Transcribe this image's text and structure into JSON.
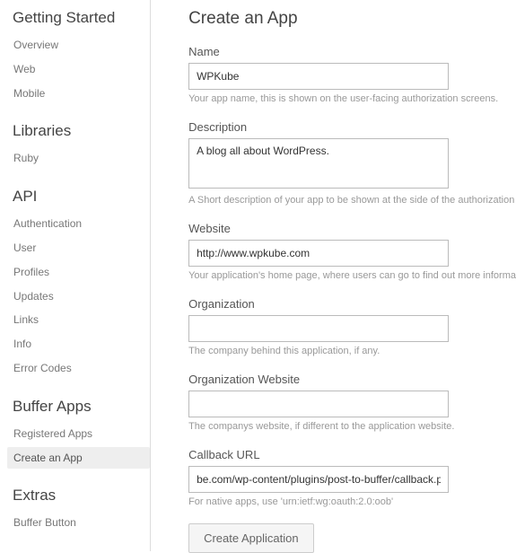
{
  "sidebar": {
    "sections": [
      {
        "header": "Getting Started",
        "items": [
          {
            "label": "Overview",
            "active": false
          },
          {
            "label": "Web",
            "active": false
          },
          {
            "label": "Mobile",
            "active": false
          }
        ]
      },
      {
        "header": "Libraries",
        "items": [
          {
            "label": "Ruby",
            "active": false
          }
        ]
      },
      {
        "header": "API",
        "items": [
          {
            "label": "Authentication",
            "active": false
          },
          {
            "label": "User",
            "active": false
          },
          {
            "label": "Profiles",
            "active": false
          },
          {
            "label": "Updates",
            "active": false
          },
          {
            "label": "Links",
            "active": false
          },
          {
            "label": "Info",
            "active": false
          },
          {
            "label": "Error Codes",
            "active": false
          }
        ]
      },
      {
        "header": "Buffer Apps",
        "items": [
          {
            "label": "Registered Apps",
            "active": false
          },
          {
            "label": "Create an App",
            "active": true
          }
        ]
      },
      {
        "header": "Extras",
        "items": [
          {
            "label": "Buffer Button",
            "active": false
          }
        ]
      }
    ]
  },
  "main": {
    "title": "Create an App",
    "fields": {
      "name": {
        "label": "Name",
        "value": "WPKube",
        "help": "Your app name, this is shown on the user-facing authorization screens."
      },
      "description": {
        "label": "Description",
        "value": "A blog all about WordPress.",
        "help": "A Short description of your app to be shown at the side of the authorization"
      },
      "website": {
        "label": "Website",
        "value": "http://www.wpkube.com",
        "help": "Your application's home page, where users can go to find out more informa"
      },
      "organization": {
        "label": "Organization",
        "value": "",
        "help": "The company behind this application, if any."
      },
      "organization_website": {
        "label": "Organization Website",
        "value": "",
        "help": "The companys website, if different to the application website."
      },
      "callback_url": {
        "label": "Callback URL",
        "value": "be.com/wp-content/plugins/post-to-buffer/callback.php",
        "help": "For native apps, use 'urn:ietf:wg:oauth:2.0:oob'"
      }
    },
    "submit_label": "Create Application"
  }
}
